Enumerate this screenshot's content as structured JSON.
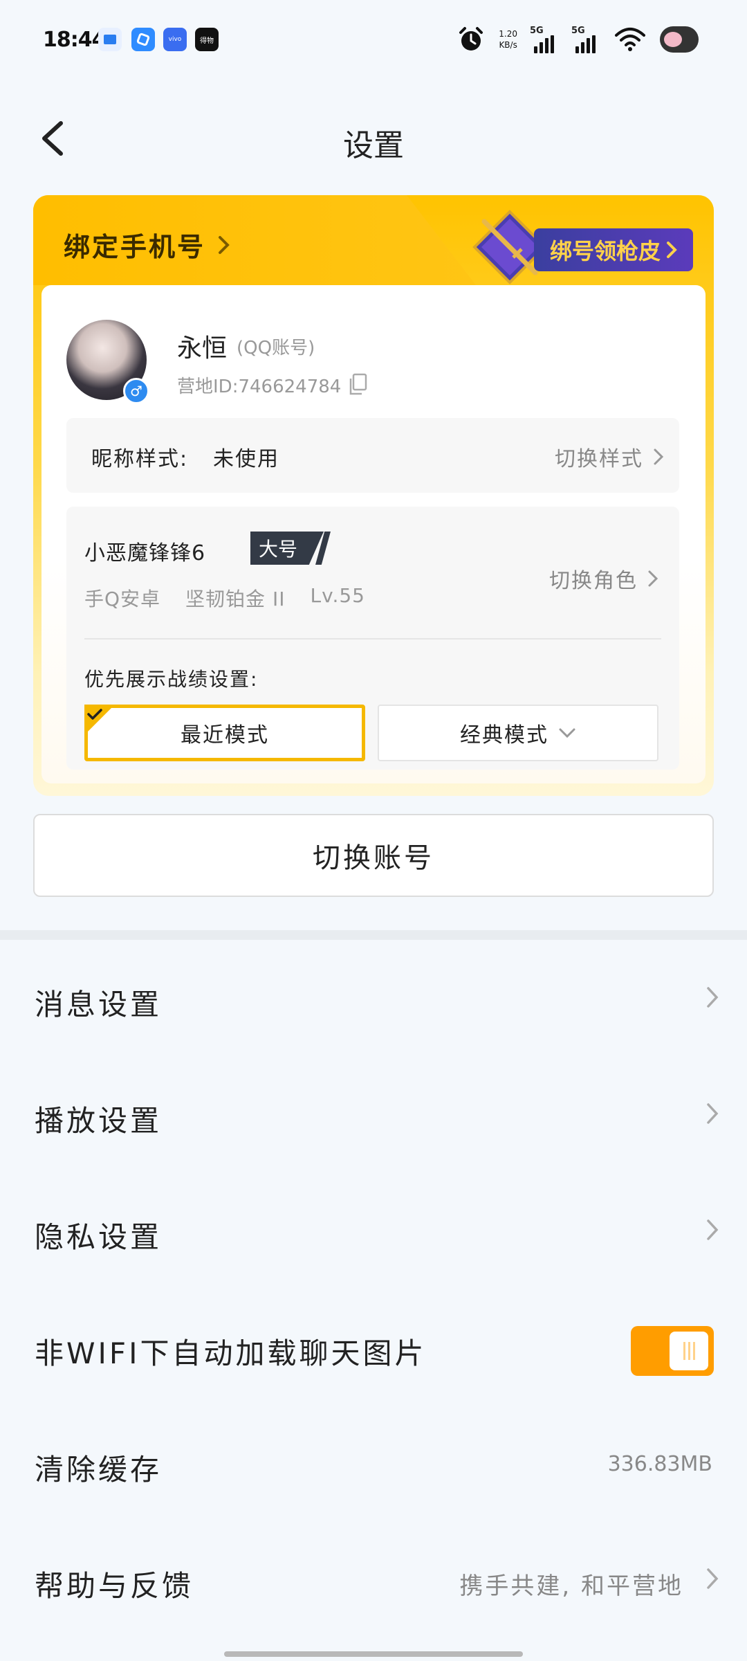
{
  "status_bar": {
    "time": "18:44",
    "speed_value": "1.20",
    "speed_unit": "KB/s",
    "sim1": "5G",
    "sim2": "5G",
    "app3_text": "vivo",
    "app4_text": "得物"
  },
  "header": {
    "title": "设置",
    "back_icon": "chevron-left-icon"
  },
  "card": {
    "bind_phone_label": "绑定手机号",
    "promo_label": "绑号领枪皮",
    "user": {
      "name": "永恒",
      "account_type": "(QQ账号)",
      "camp_id": "营地ID:746624784",
      "gender_symbol": "♂"
    },
    "nickname": {
      "label": "昵称样式:",
      "value": "未使用",
      "switch_label": "切换样式"
    },
    "role": {
      "name": "小恶魔锋锋6",
      "tag": "大号",
      "platform": "手Q安卓",
      "rank": "坚韧铂金 II",
      "level": "Lv.55",
      "switch_label": "切换角色"
    },
    "record_pref": {
      "label": "优先展示战绩设置:",
      "mode_recent": "最近模式",
      "mode_classic": "经典模式"
    }
  },
  "switch_account_label": "切换账号",
  "settings": {
    "message": "消息设置",
    "playback": "播放设置",
    "privacy": "隐私设置",
    "auto_load": "非WIFI下自动加载聊天图片",
    "auto_load_on": true,
    "clear_cache": "清除缓存",
    "cache_size": "336.83MB",
    "help": "帮助与反馈",
    "help_hint": "携手共建, 和平营地"
  },
  "colors": {
    "accent": "#FFC300",
    "toggle_on": "#FF9D00",
    "promo_bg": "#4A3DB0",
    "gender_badge": "#2E8BF0"
  }
}
